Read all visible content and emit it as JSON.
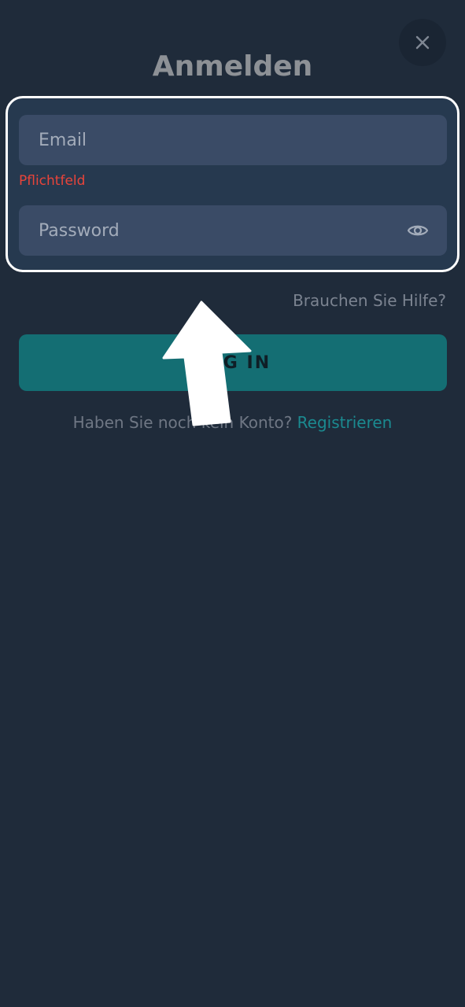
{
  "header": {
    "title": "Anmelden",
    "close_icon": "close-icon"
  },
  "form": {
    "email_placeholder": "Email",
    "email_error": "Pflichtfeld",
    "password_placeholder": "Password",
    "password_toggle_icon": "eye-icon"
  },
  "help": {
    "label": "Brauchen Sie Hilfe?"
  },
  "login_button": {
    "label": "LOG IN"
  },
  "register": {
    "prompt": "Haben Sie noch kein Konto?",
    "link_label": "Registrieren"
  },
  "colors": {
    "background": "#1f2b3a",
    "field_background": "#3a4b66",
    "accent": "#146e73",
    "link": "#1b8a90",
    "error": "#e8443a",
    "highlight_border": "#ffffff"
  },
  "annotation": {
    "highlight_icon": "arrow-up-icon"
  }
}
